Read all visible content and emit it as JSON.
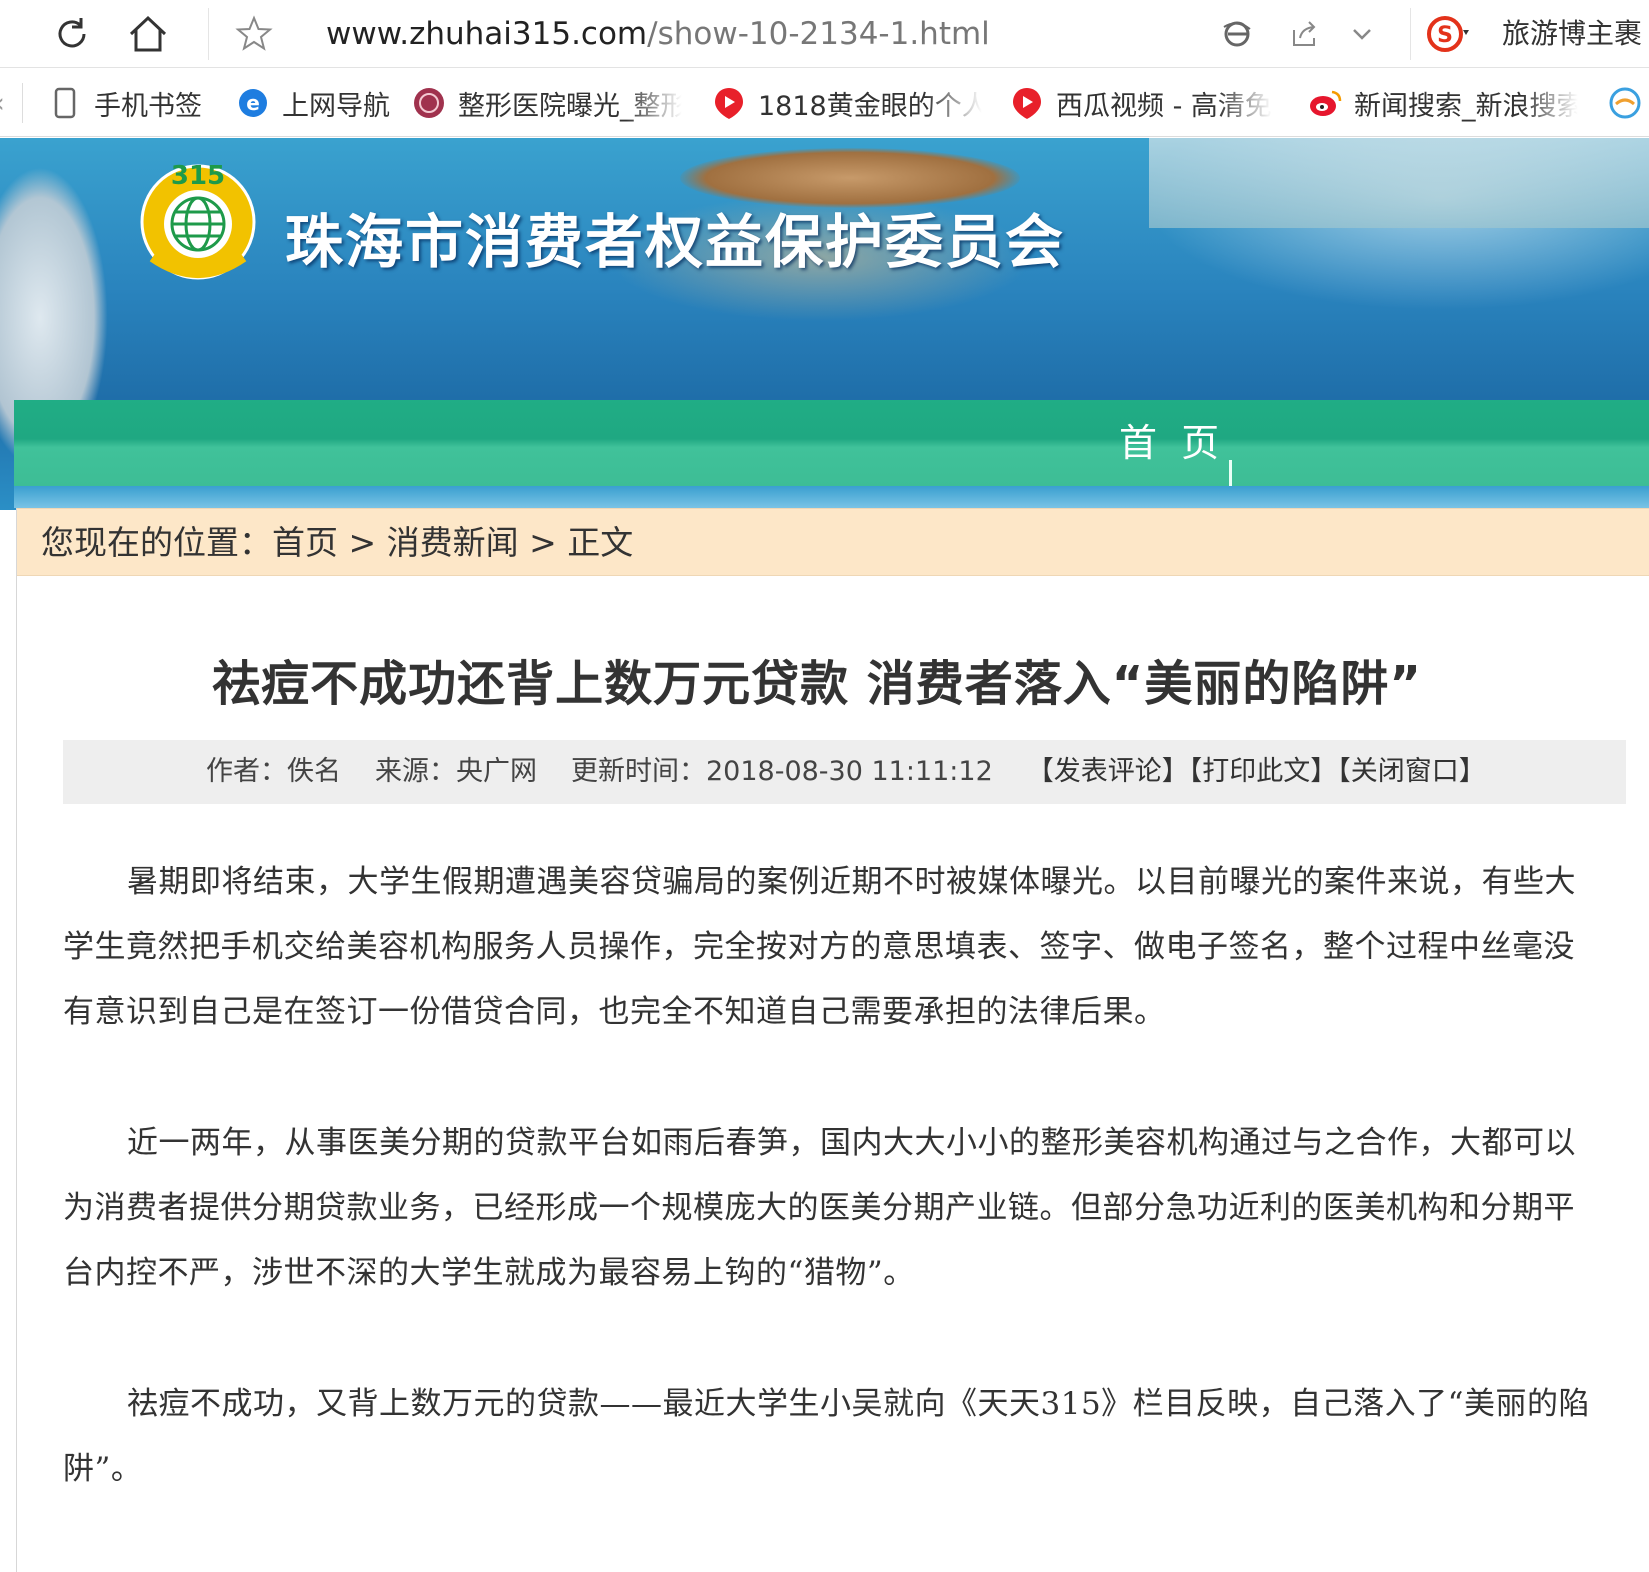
{
  "browser": {
    "url_domain": "www.zhuhai315.com",
    "url_path": "/show-10-2134-1.html",
    "search_engine_label": "旅游博主裹"
  },
  "bookmarks": [
    {
      "label": "手机书签",
      "icon": "phone-icon"
    },
    {
      "label": "上网导航",
      "icon": "ie-icon"
    },
    {
      "label": "整形医院曝光_整形",
      "icon": "hospital-icon"
    },
    {
      "label": "1818黄金眼的个人",
      "icon": "video-play-icon"
    },
    {
      "label": "西瓜视频 - 高清免",
      "icon": "video-play-icon"
    },
    {
      "label": "新闻搜索_新浪搜索",
      "icon": "weibo-icon"
    }
  ],
  "site": {
    "logo_text": "315",
    "title": "珠海市消费者权益保护委员会",
    "nav_home": "首 页"
  },
  "breadcrumb": {
    "prefix": "您现在的位置：",
    "home": "首页",
    "sep1": " > ",
    "category": "消费新闻",
    "sep2": " > ",
    "current": "正文"
  },
  "article": {
    "title": "祛痘不成功还背上数万元贷款 消费者落入“美丽的陷阱”",
    "author": "作者：佚名",
    "source": "来源：央广网",
    "updated": "更新时间：2018-08-30 11:11:12",
    "comment_link": "【发表评论】",
    "print_link": "【打印此文】",
    "close_link": "【关闭窗口】",
    "paragraphs": [
      "暑期即将结束，大学生假期遭遇美容贷骗局的案例近期不时被媒体曝光。以目前曝光的案件来说，有些大学生竟然把手机交给美容机构服务人员操作，完全按对方的意思填表、签字、做电子签名，整个过程中丝毫没有意识到自己是在签订一份借贷合同，也完全不知道自己需要承担的法律后果。",
      "近一两年，从事医美分期的贷款平台如雨后春笋，国内大大小小的整形美容机构通过与之合作，大都可以为消费者提供分期贷款业务，已经形成一个规模庞大的医美分期产业链。但部分急功近利的医美机构和分期平台内控不严，涉世不深的大学生就成为最容易上钩的“猎物”。",
      "祛痘不成功，又背上数万元的贷款——最近大学生小吴就向《天天315》栏目反映，自己落入了“美丽的陷阱”。"
    ]
  },
  "colors": {
    "nav_green": "#20ad85",
    "breadcrumb_bg": "#fde7c8",
    "meta_bg": "#eeeeee",
    "logo_yellow": "#f2c200"
  }
}
